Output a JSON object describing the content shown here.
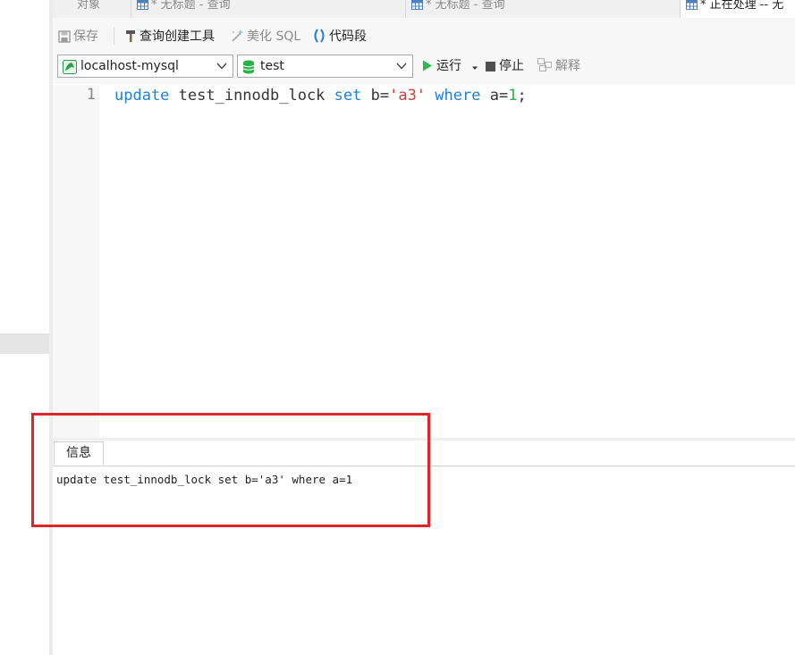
{
  "tabs": [
    {
      "label": "对象",
      "active": false
    },
    {
      "label": "* 无标题 - 查询",
      "active": false,
      "icon": "table-grid-icon"
    },
    {
      "label": "* 无标题 - 查询",
      "active": false,
      "icon": "table-grid-icon"
    },
    {
      "label": "* 正在处理 -- 无",
      "active": true,
      "icon": "table-grid-icon"
    }
  ],
  "toolbar": {
    "save": "保存",
    "query_builder": "查询创建工具",
    "beautify_sql": "美化 SQL",
    "snippet": "代码段"
  },
  "connection": {
    "selected": "localhost-mysql",
    "icon": "mysql-dolphin-icon"
  },
  "database": {
    "selected": "test",
    "icon": "database-cylinder-icon"
  },
  "actions": {
    "run": "运行",
    "stop": "停止",
    "explain": "解释"
  },
  "editor": {
    "line_number": "1",
    "tokens": {
      "kw_update": "update",
      "table": " test_innodb_lock ",
      "kw_set": "set",
      "col_b": " b=",
      "value": "'a3'",
      "space": " ",
      "kw_where": "where",
      "col_a": " a=",
      "num": "1",
      "end": ";"
    }
  },
  "info": {
    "tab_label": "信息",
    "message": "update test_innodb_lock set b='a3' where a=1"
  },
  "colors": {
    "keyword": "#1e7fd4",
    "string": "#d43a3a",
    "number": "#2ab24a",
    "highlight": "#e0242b",
    "run_green": "#2db84d"
  }
}
